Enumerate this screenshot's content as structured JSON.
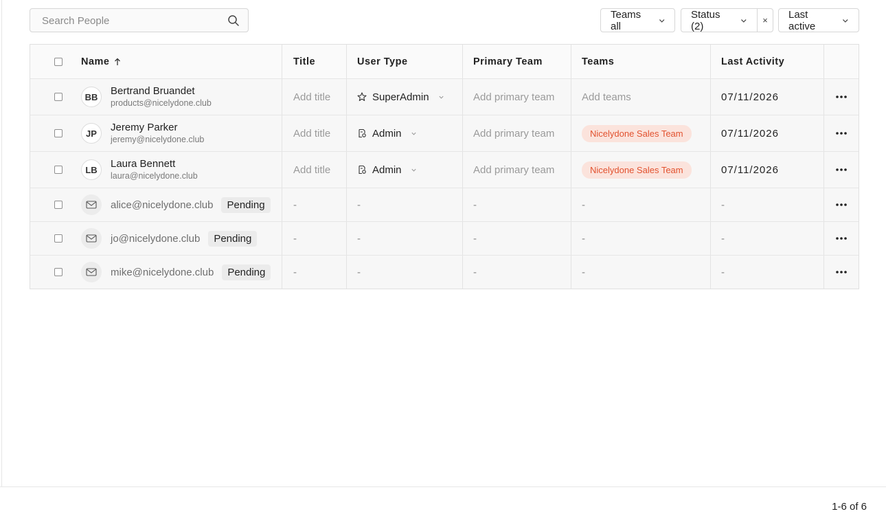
{
  "search": {
    "placeholder": "Search People"
  },
  "filters": {
    "teams_label": "Teams all",
    "status_label": "Status (2)",
    "clear_label": "×",
    "sort_label": "Last active"
  },
  "table": {
    "headers": {
      "name": "Name",
      "title": "Title",
      "user_type": "User Type",
      "primary_team": "Primary Team",
      "teams": "Teams",
      "last_activity": "Last Activity"
    },
    "users": [
      {
        "initials": "BB",
        "name": "Bertrand Bruandet",
        "email": "products@nicelydone.club",
        "title": "Add title",
        "user_type": "SuperAdmin",
        "user_type_icon": "star-icon",
        "primary_team": "Add primary team",
        "teams": "Add teams",
        "last_activity": "07/11/2026"
      },
      {
        "initials": "JP",
        "name": "Jeremy Parker",
        "email": "jeremy@nicelydone.club",
        "title": "Add title",
        "user_type": "Admin",
        "user_type_icon": "admin-badge-icon",
        "primary_team": "Add primary team",
        "teams": "Nicelydone Sales Team",
        "last_activity": "07/11/2026"
      },
      {
        "initials": "LB",
        "name": "Laura Bennett",
        "email": "laura@nicelydone.club",
        "title": "Add title",
        "user_type": "Admin",
        "user_type_icon": "admin-badge-icon",
        "primary_team": "Add primary team",
        "teams": "Nicelydone Sales Team",
        "last_activity": "07/11/2026"
      }
    ],
    "invites": [
      {
        "email": "alice@nicelydone.club",
        "status": "Pending",
        "title": "-",
        "user_type": "-",
        "primary_team": "-",
        "teams": "-",
        "last_activity": "-"
      },
      {
        "email": "jo@nicelydone.club",
        "status": "Pending",
        "title": "-",
        "user_type": "-",
        "primary_team": "-",
        "teams": "-",
        "last_activity": "-"
      },
      {
        "email": "mike@nicelydone.club",
        "status": "Pending",
        "title": "-",
        "user_type": "-",
        "primary_team": "-",
        "teams": "-",
        "last_activity": "-"
      }
    ]
  },
  "pagination": {
    "label": "1-6 of 6"
  },
  "colors": {
    "team_badge_bg": "#fbe3dc",
    "team_badge_text": "#e2522f"
  }
}
